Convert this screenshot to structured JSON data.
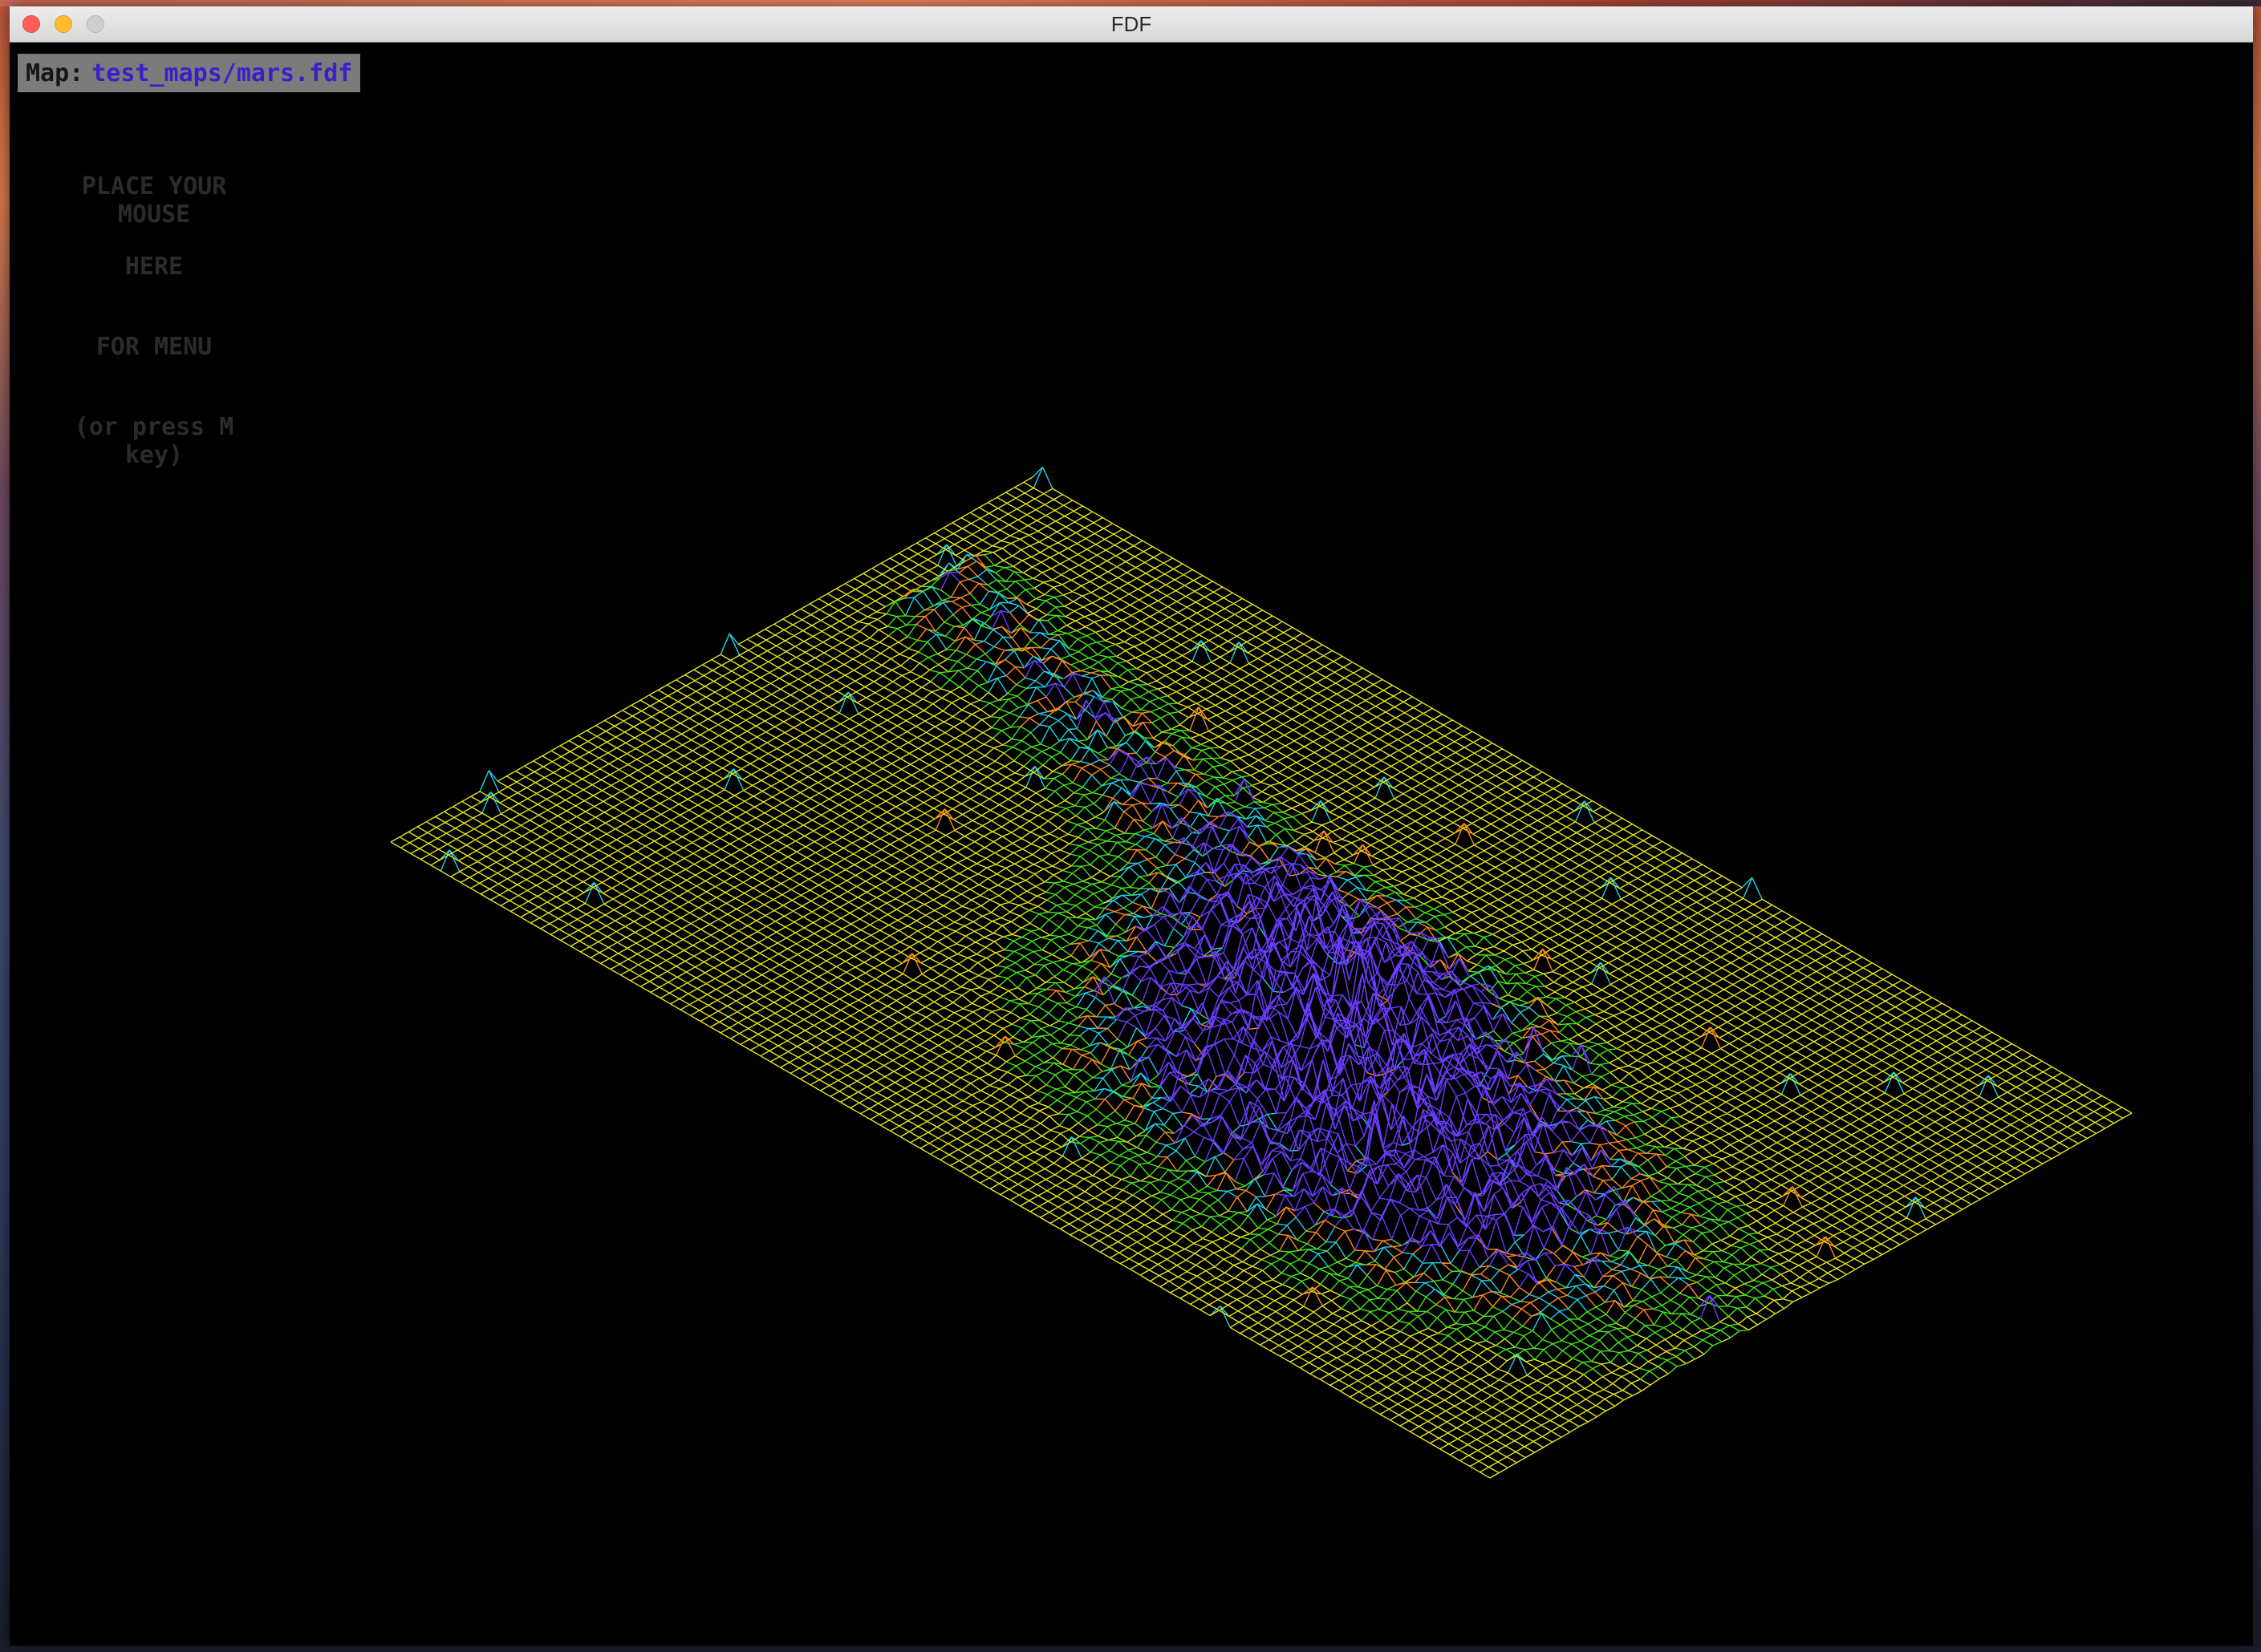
{
  "window": {
    "title": "FDF"
  },
  "map_info": {
    "label": "Map:",
    "value": "test_maps/mars.fdf"
  },
  "menu_hint": {
    "line1": "PLACE YOUR MOUSE",
    "line2": "HERE",
    "line3": "FOR MENU",
    "line4": "(or press M key)"
  },
  "colors": {
    "base_grid": "#e6e61e",
    "mid_height": "#46e61e",
    "high_a": "#ff8a1e",
    "high_b": "#1ed2e6",
    "peak": "#6a3cff",
    "background": "#000000",
    "map_box_bg": "#7b7b7b",
    "map_path_color": "#3a20c9"
  },
  "icons": {
    "close": "close-dot-icon",
    "minimize": "minimize-dot-icon",
    "zoom": "zoom-dot-icon"
  }
}
